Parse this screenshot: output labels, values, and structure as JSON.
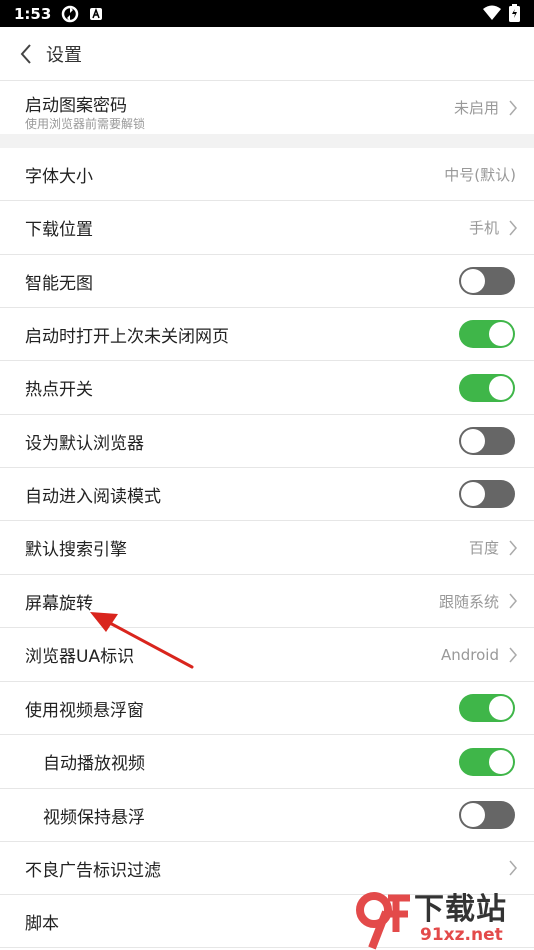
{
  "status": {
    "time": "1:53"
  },
  "header": {
    "title": "设置"
  },
  "settings": [
    {
      "label": "启动图案密码",
      "sub": "使用浏览器前需要解锁",
      "value": "未启用"
    },
    {
      "label": "字体大小",
      "value": "中号(默认)"
    },
    {
      "label": "下载位置",
      "value": "手机"
    },
    {
      "label": "智能无图",
      "toggle": false
    },
    {
      "label": "启动时打开上次未关闭网页",
      "toggle": true
    },
    {
      "label": "热点开关",
      "toggle": true
    },
    {
      "label": "设为默认浏览器",
      "toggle": false
    },
    {
      "label": "自动进入阅读模式",
      "toggle": false
    },
    {
      "label": "默认搜索引擎",
      "value": "百度"
    },
    {
      "label": "屏幕旋转",
      "value": "跟随系统"
    },
    {
      "label": "浏览器UA标识",
      "value": "Android"
    },
    {
      "label": "使用视频悬浮窗",
      "toggle": true
    },
    {
      "label": "自动播放视频",
      "toggle": true
    },
    {
      "label": "视频保持悬浮",
      "toggle": false
    },
    {
      "label": "不良广告标识过滤"
    },
    {
      "label": "脚本"
    }
  ],
  "watermark": {
    "text_cn": "下载站",
    "text_url": "91xz.net",
    "logo": "9f"
  },
  "colors": {
    "toggle_on": "#3fb649",
    "toggle_off": "#666666",
    "annotation_arrow": "#d9251d"
  }
}
